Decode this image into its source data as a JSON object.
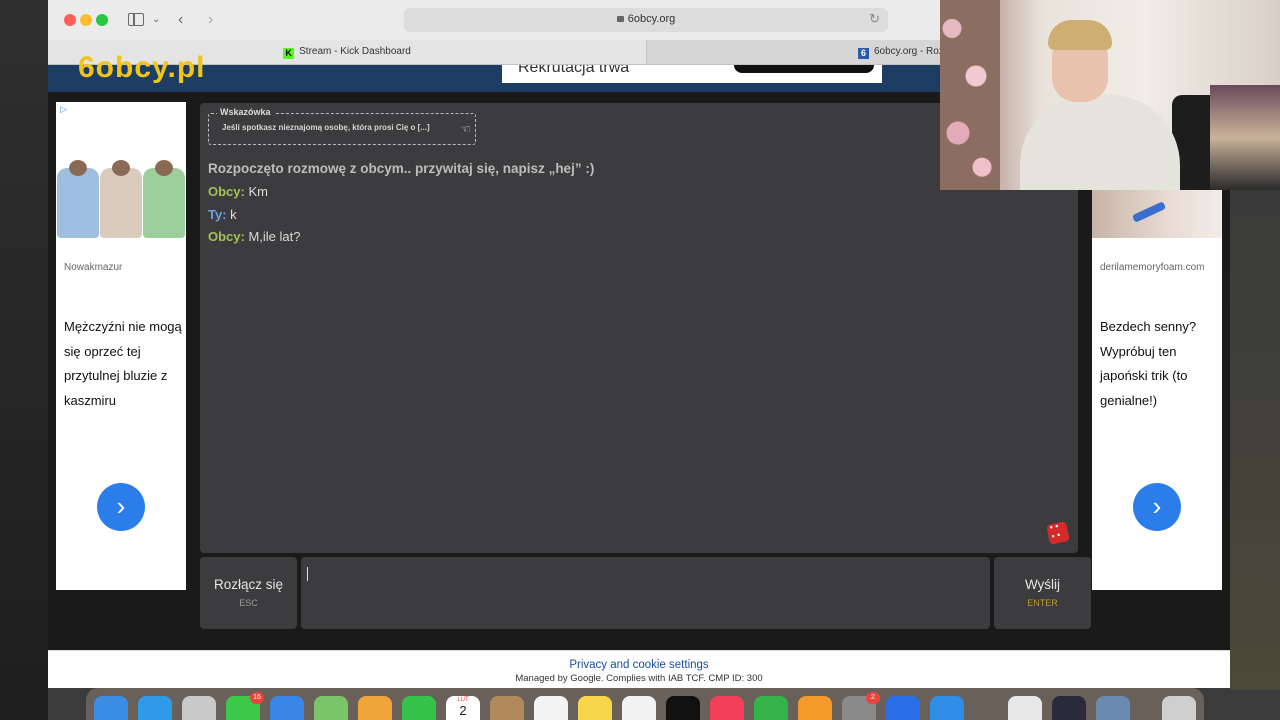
{
  "browser": {
    "url": "6obcy.org",
    "tabs": [
      {
        "label": "Stream - Kick Dashboard",
        "favicon": "K"
      },
      {
        "label": "6obcy.org - Roz",
        "favicon": "6"
      }
    ]
  },
  "site": {
    "logo": "6obcy.pl",
    "header_ad_text": "Rekrutacja trwa"
  },
  "ads": {
    "left": {
      "source": "Nowakmazur",
      "text": "Mężczyźni nie mogą się oprzeć tej przytulnej bluzie z kaszmiru",
      "cta": "›"
    },
    "right": {
      "source": "derilamemoryfoam.com",
      "text": "Bezdech senny? Wypróbuj ten japoński trik (to genialne!)",
      "cta": "›"
    }
  },
  "chat": {
    "hint_title": "Wskazówka",
    "hint_text": "Jeśli spotkasz nieznajomą osobę, która prosi Cię o [...]",
    "system_message": "Rozpoczęto rozmowę z obcym.. przywitaj się, napisz „hej” :)",
    "messages": [
      {
        "sender": "Obcy:",
        "text": "Km"
      },
      {
        "sender": "Ty:",
        "text": "k"
      },
      {
        "sender": "Obcy:",
        "text": "M,ile lat?"
      }
    ],
    "input_value": ""
  },
  "controls": {
    "disconnect_label": "Rozłącz się",
    "disconnect_key": "ESC",
    "send_label": "Wyślij",
    "send_key": "ENTER"
  },
  "footer": {
    "link": "Privacy and cookie settings",
    "note": "Managed by Google. Complies with IAB TCF. CMP ID: 300"
  },
  "dock": {
    "badges": {
      "messages": "16",
      "system_settings": "2"
    },
    "calendar_month": "LUT",
    "calendar_day": "2"
  },
  "colors": {
    "obcy": "#a2c255",
    "ty": "#6ea0e0",
    "panel": "#3c3c3e",
    "header": "#1e3d62"
  }
}
